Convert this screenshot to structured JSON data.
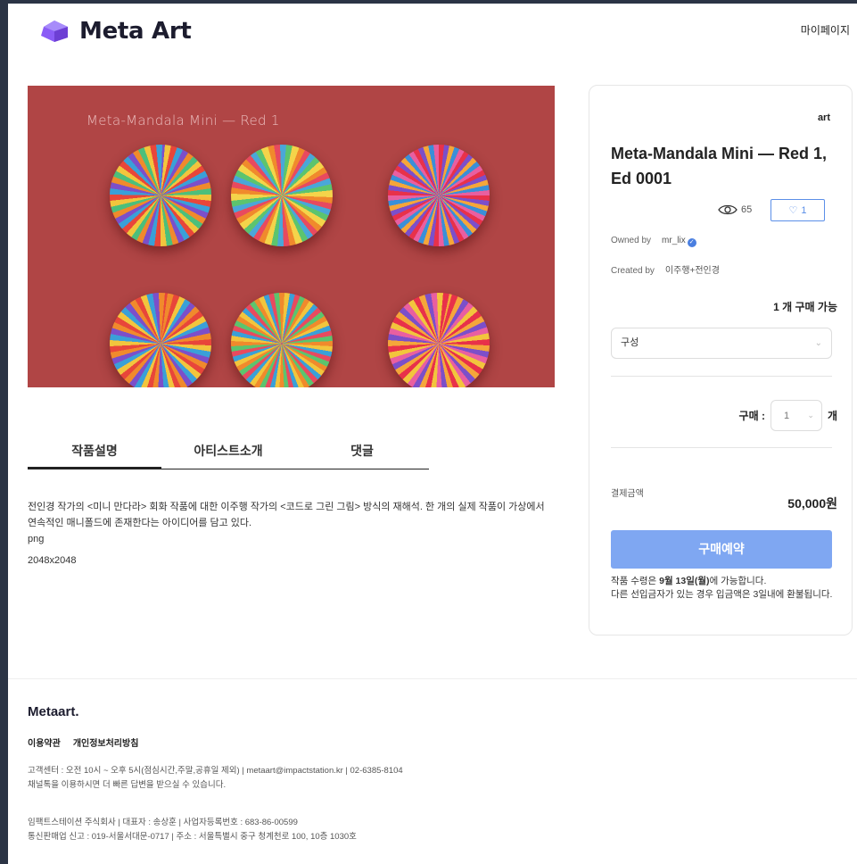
{
  "header": {
    "logo_text": "Meta Art",
    "mypage_label": "마이페이지"
  },
  "artwork": {
    "overlay_title": "Meta-Mandala Mini — Red 1",
    "bg_color": "#b04545"
  },
  "tabs": [
    {
      "label": "작품설명",
      "active": true
    },
    {
      "label": "아티스트소개",
      "active": false
    },
    {
      "label": "댓글",
      "active": false
    }
  ],
  "description": {
    "text": "전인경 작가의 <미니 만다라> 회화 작품에 대한 이주행 작가의 <코드로 그린 그림> 방식의 재해석. 한 개의 실제 작품이 가상에서 연속적인 매니폴드에 존재한다는 아이디어를 담고 있다.",
    "format": "png",
    "resolution": "2048x2048"
  },
  "item": {
    "category": "art",
    "title": "Meta-Mandala Mini — Red 1, Ed 0001",
    "views": "65",
    "likes": "1",
    "owned_by_label": "Owned by",
    "owner": "mr_lix",
    "created_by_label": "Created by",
    "creator": "이주행+전인경",
    "available_count": "1",
    "available_suffix": "개 구매 가능",
    "select_placeholder": "구성",
    "purchase_label": "구매 :",
    "quantity": "1",
    "quantity_unit": "개",
    "payment_label": "결제금액",
    "payment_amount": "50,000원",
    "buy_button": "구매예약",
    "notice_prefix": "작품 수령은 ",
    "notice_date": "9월 13일(월)",
    "notice_suffix": "에 가능합니다.",
    "notice_line2": "다른 선입금자가 있는 경우 입금액은 3일내에 환불됩니다.",
    "accent_color": "#5b8fe8",
    "button_color": "#7fa7f2"
  },
  "footer": {
    "logo": "Metaart.",
    "terms": "이용약관",
    "privacy": "개인정보처리방침",
    "cs_line1": "고객센터 : 오전 10시 ~ 오후 5시(점심시간,주말,공휴일 제외) | metaart@impactstation.kr | 02-6385-8104",
    "cs_line2": "채널톡을 이용하시면 더 빠른 답변을 받으실 수 있습니다.",
    "company_line1": "임팩트스테이션 주식회사 | 대표자 : 송상훈 | 사업자등록번호 : 683-86-00599",
    "company_line2": "통신판매업 신고 : 019-서울서대문-0717 | 주소 : 서울특별시 중구 청계천로 100, 10층 1030호"
  }
}
